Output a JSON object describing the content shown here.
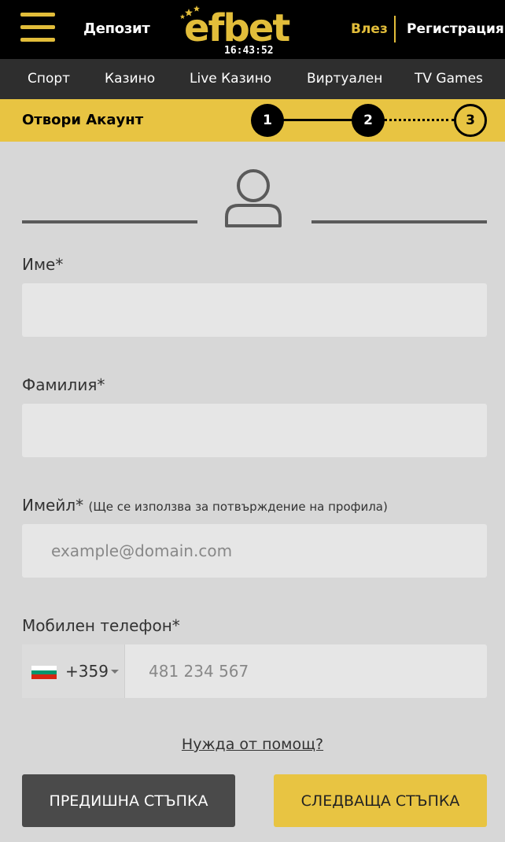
{
  "header": {
    "deposit": "Депозит",
    "logo_text": "efbet",
    "clock": "16:43:52",
    "login": "Влез",
    "register": "Регистрация"
  },
  "nav": {
    "items": [
      "Спорт",
      "Казино",
      "Live Казино",
      "Виртуален",
      "TV Games"
    ]
  },
  "steps": {
    "title": "Отвори Акаунт",
    "numbers": [
      "1",
      "2",
      "3"
    ]
  },
  "form": {
    "first_name": {
      "label": "Име*",
      "value": "",
      "placeholder": ""
    },
    "last_name": {
      "label": "Фамилия*",
      "value": "",
      "placeholder": ""
    },
    "email": {
      "label": "Имейл*",
      "hint": "(Ще се използва за потвърждение на профила)",
      "value": "",
      "placeholder": "example@domain.com"
    },
    "phone": {
      "label": "Мобилен телефон*",
      "country_code": "+359",
      "value": "",
      "placeholder": "481 234 567"
    }
  },
  "help": "Нужда от помощ?",
  "buttons": {
    "prev": "ПРЕДИШНА СТЪПКА",
    "next": "СЛЕДВАЩА СТЪПКА"
  },
  "colors": {
    "accent": "#e8c442",
    "header_bg": "#000000",
    "nav_bg": "#2e2e2e",
    "page_bg": "#d7d7d7"
  },
  "icons": [
    "menu-icon",
    "user-icon",
    "chevron-down-icon",
    "bulgaria-flag-icon"
  ]
}
